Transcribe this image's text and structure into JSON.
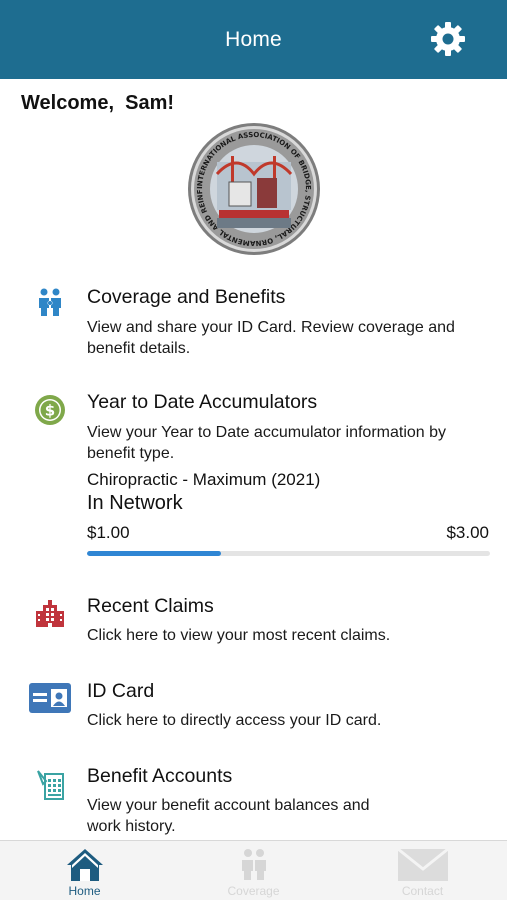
{
  "header": {
    "title": "Home",
    "settings_icon": "gear-icon"
  },
  "welcome": {
    "text": "Welcome,  Sam!"
  },
  "logo": {
    "name": "association-seal",
    "ring_text": "INTERNATIONAL ASSOCIATION OF BRIDGE, STRUCTURAL, ORNAMENTAL AND REINFORCING IRON WORKERS"
  },
  "sections": {
    "coverage": {
      "icon": "family-icon",
      "title": "Coverage and Benefits",
      "desc_line1": "View and share your ID Card. Review coverage and",
      "desc_line2": "benefit details."
    },
    "accumulators": {
      "icon": "dollar-icon",
      "title": "Year to Date Accumulators",
      "desc_line1": "View your Year to Date accumulator information by",
      "desc_line2": "benefit type.",
      "item": {
        "name": "Chiropractic - Maximum (2021)",
        "network": "In Network",
        "min_label": "$1.00",
        "max_label": "$3.00",
        "progress": 0.333
      }
    },
    "claims": {
      "icon": "building-icon",
      "title": "Recent Claims",
      "desc_line1": "Click here to view your most recent claims."
    },
    "idcard": {
      "icon": "id-card-icon",
      "title": "ID Card",
      "desc_line1": "Click here to directly access your ID card."
    },
    "accounts": {
      "icon": "receipt-icon",
      "title": "Benefit Accounts",
      "desc_line1": "View your benefit account balances and",
      "desc_line2": "work history."
    }
  },
  "tabbar": {
    "tabs": [
      {
        "label": "Home",
        "icon": "home-icon",
        "active": true
      },
      {
        "label": "Coverage",
        "icon": "family-icon",
        "active": false
      },
      {
        "label": "Contact",
        "icon": "envelope-icon",
        "active": false
      }
    ]
  },
  "colors": {
    "header_bg": "#1e6d90",
    "progress_fill": "#2f86d4",
    "coverage_icon": "#2f86c7",
    "dollar_icon": "#7fa84a",
    "claims_icon": "#c0343c",
    "idcard_icon": "#3f77b8",
    "accounts_icon": "#3aa3a3"
  }
}
